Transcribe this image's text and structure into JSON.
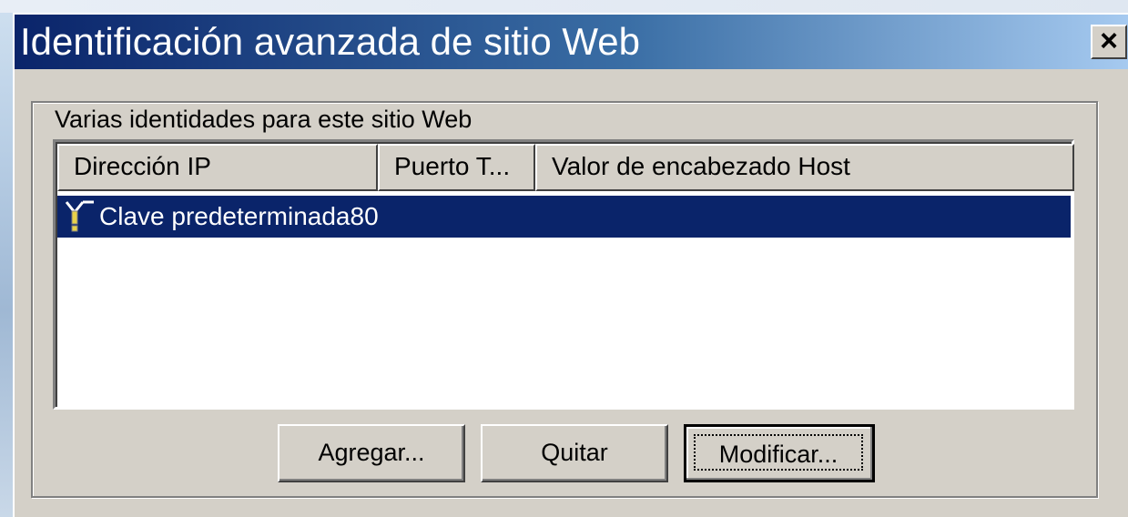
{
  "window": {
    "title": "Identificación avanzada de sitio Web",
    "close_label": "×"
  },
  "group": {
    "label": "Varias identidades para este sitio Web"
  },
  "list": {
    "columns": [
      "Dirección IP",
      "Puerto T...",
      "Valor de encabezado Host"
    ],
    "rows": [
      {
        "icon": "key-icon",
        "ip": "Clave predeterminada",
        "port": "80",
        "host": ""
      }
    ],
    "selected_row": 0,
    "selection_color": "#0a246a"
  },
  "buttons": {
    "add": "Agregar...",
    "remove": "Quitar",
    "modify": "Modificar..."
  },
  "colors": {
    "titlebar_start": "#0a246a",
    "titlebar_end": "#a6caf0",
    "face": "#d4d0c8"
  }
}
